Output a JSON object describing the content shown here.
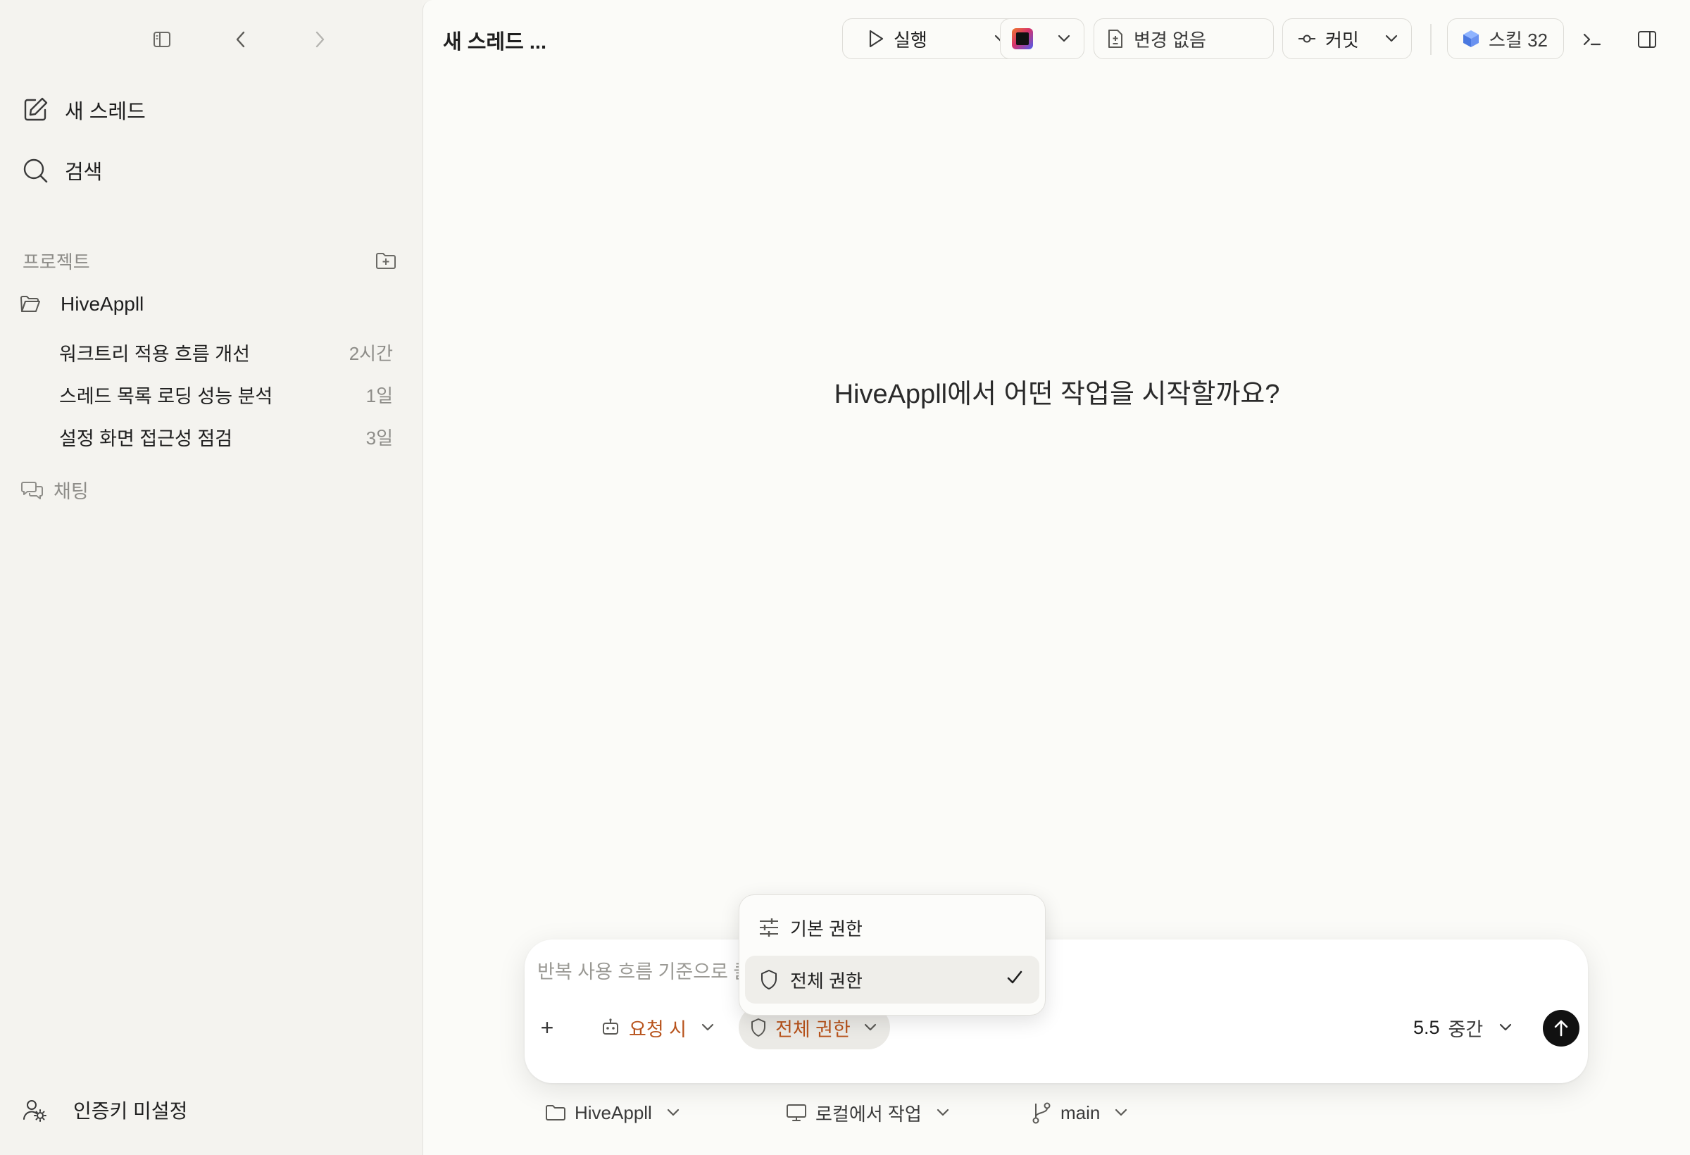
{
  "sidebar": {
    "nav": {
      "new_thread": "새 스레드",
      "search": "검색"
    },
    "projects_label": "프로젝트",
    "project": {
      "name": "HiveAppll",
      "threads": [
        {
          "title": "워크트리 적용 흐름 개선",
          "time": "2시간"
        },
        {
          "title": "스레드 목록 로딩 성능 분석",
          "time": "1일"
        },
        {
          "title": "설정 화면 접근성 점검",
          "time": "3일"
        }
      ]
    },
    "chat": "채팅",
    "auth": "인증키 미설정"
  },
  "header": {
    "title": "새 스레드 ...",
    "run": "실행",
    "changes": "변경 없음",
    "commit": "커밋",
    "skills": "스킬 32"
  },
  "main": {
    "headline": "HiveAppll에서 어떤 작업을 시작할까요?"
  },
  "composer": {
    "placeholder": "반복 사용 흐름 기준으로 클",
    "approval": "요청 시",
    "permission": "전체 권한",
    "model": "5.5",
    "effort": "중간",
    "add": "+"
  },
  "footer": {
    "project": "HiveAppll",
    "environment": "로컬에서 작업",
    "branch": "main"
  },
  "permission_menu": {
    "items": [
      {
        "label": "기본 권한",
        "icon": "sliders-icon",
        "selected": false
      },
      {
        "label": "전체 권한",
        "icon": "shield-icon",
        "selected": true
      }
    ]
  },
  "colors": {
    "accent": "#b8531c",
    "sidebar_bg": "#f4f3ef",
    "main_bg": "#fbfbf8",
    "send_button": "#111111"
  }
}
